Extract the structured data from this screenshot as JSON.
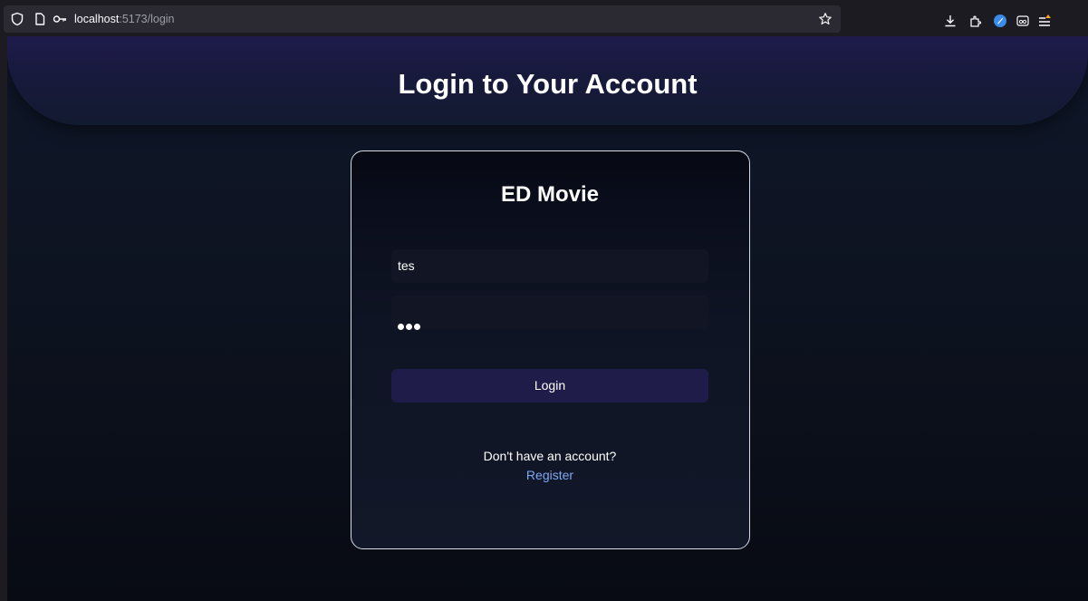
{
  "browser": {
    "url_host": "localhost",
    "url_path": ":5173/login",
    "icons": [
      "shield-icon",
      "page-icon",
      "key-icon",
      "star-icon",
      "download-icon",
      "extensions-icon",
      "account-icon",
      "reader-view-icon",
      "menu-icon"
    ]
  },
  "header": {
    "title": "Login to Your Account"
  },
  "card": {
    "title": "ED Movie",
    "username_value": "tes",
    "password_masked": "•••",
    "login_label": "Login",
    "signup_prompt": "Don't have an account?",
    "register_label": "Register"
  },
  "colors": {
    "hero": "#1e1b4b",
    "button": "#1f1c4a",
    "link": "#7fa7f0",
    "field": "#121624"
  }
}
